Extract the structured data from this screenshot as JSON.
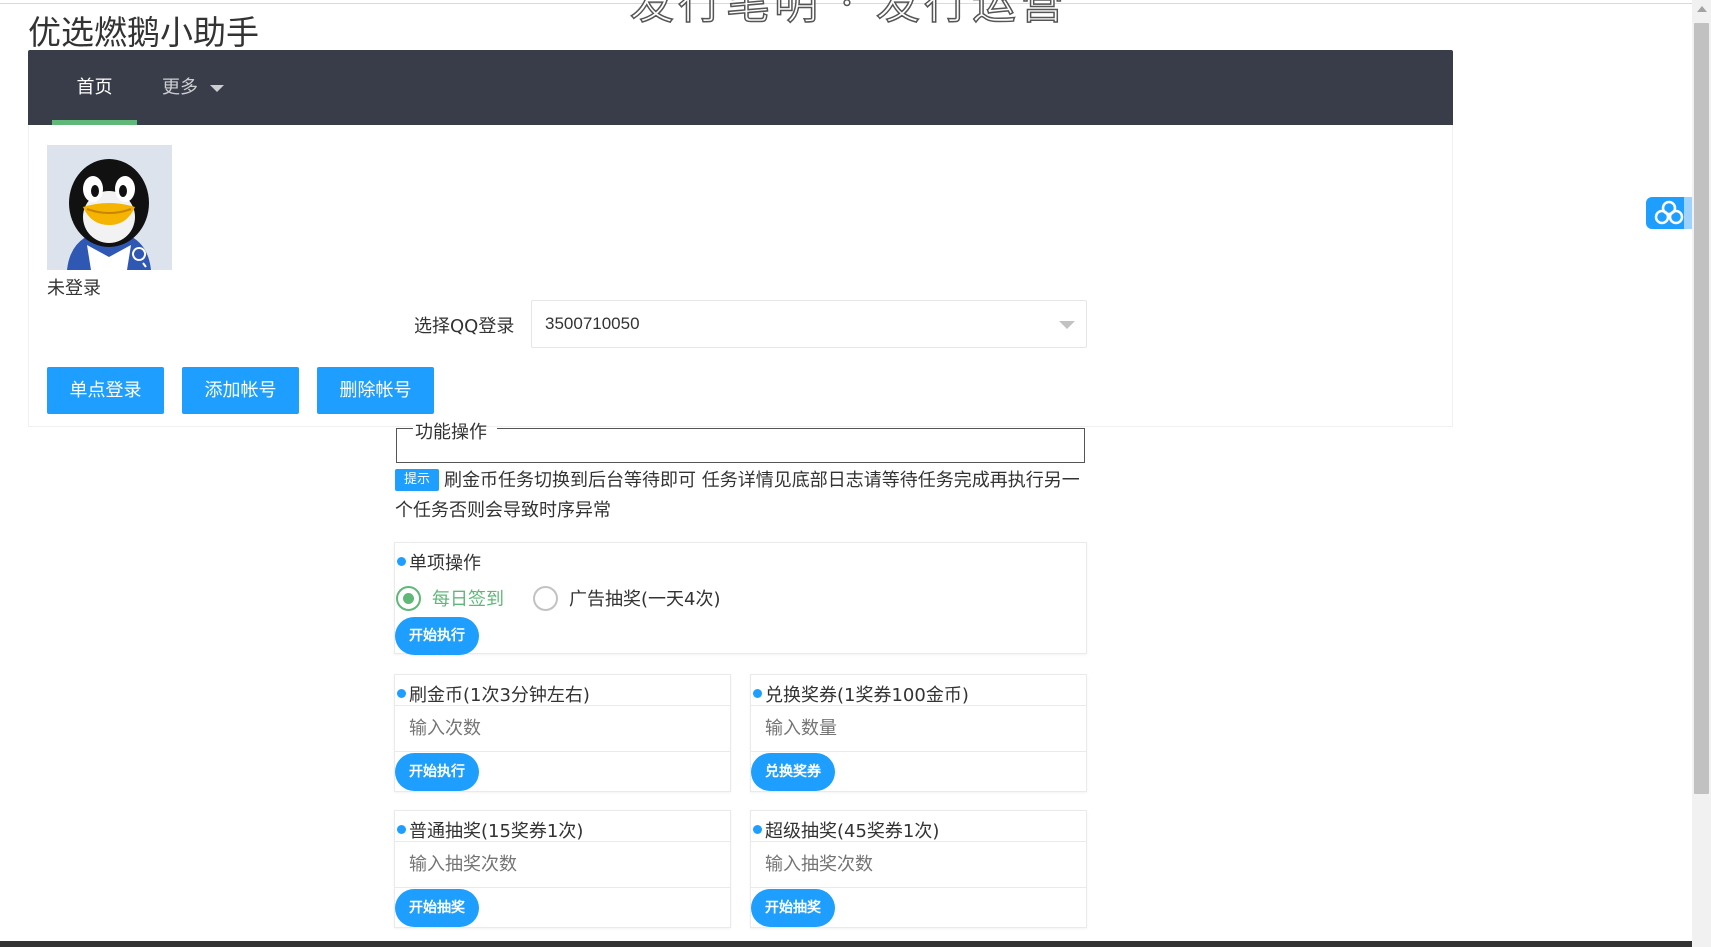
{
  "banner": "发行笔明 · 发行运营",
  "app_title": "优选燃鹅小助手",
  "nav": {
    "home_label": "首页",
    "more_label": "更多"
  },
  "account": {
    "status": "未登录",
    "select_label": "选择QQ登录",
    "selected_qq": "3500710050"
  },
  "buttons": {
    "single_login": "单点登录",
    "add_account": "添加帐号",
    "delete_account": "删除帐号"
  },
  "function_section": {
    "legend": "功能操作",
    "tip_badge": "提示",
    "tip_text": "刷金币任务切换到后台等待即可 任务详情见底部日志请等待任务完成再执行另一个任务否则会导致时序异常"
  },
  "single_ops": {
    "title": "单项操作",
    "options": [
      {
        "label": "每日签到",
        "checked": true
      },
      {
        "label": "广告抽奖(一天4次)",
        "checked": false
      }
    ],
    "button": "开始执行"
  },
  "cards": [
    {
      "title": "刷金币(1次3分钟左右)",
      "placeholder": "输入次数",
      "button": "开始执行"
    },
    {
      "title": "兑换奖券(1奖券100金币)",
      "placeholder": "输入数量",
      "button": "兑换奖券"
    },
    {
      "title": "普通抽奖(15奖券1次)",
      "placeholder": "输入抽奖次数",
      "button": "开始抽奖"
    },
    {
      "title": "超级抽奖(45奖券1次)",
      "placeholder": "输入抽奖次数",
      "button": "开始抽奖"
    }
  ],
  "float_widget": {
    "icon": "cloud-icon"
  },
  "colors": {
    "navbar": "#393d49",
    "nav_indicator": "#5fb878",
    "primary": "#1e9fff",
    "radio_checked": "#5fb878"
  }
}
